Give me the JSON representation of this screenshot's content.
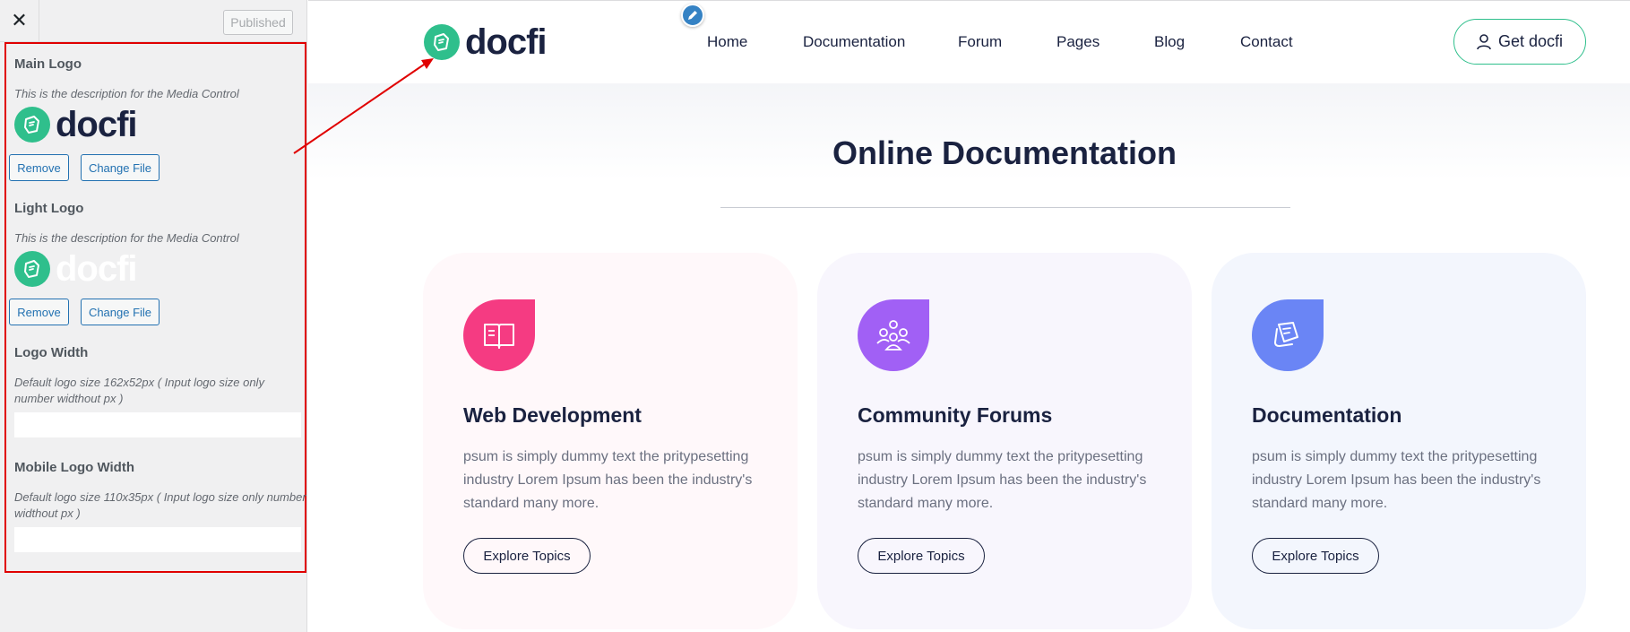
{
  "sidebar": {
    "close_glyph": "✕",
    "published_label": "Published",
    "main_logo": {
      "title": "Main Logo",
      "description": "This is the description for the Media Control",
      "remove_label": "Remove",
      "change_label": "Change File"
    },
    "light_logo": {
      "title": "Light Logo",
      "description": "This is the description for the Media Control",
      "remove_label": "Remove",
      "change_label": "Change File"
    },
    "logo_width": {
      "title": "Logo Width",
      "description": "Default logo size 162x52px ( Input logo size only number widthout px )",
      "value": ""
    },
    "mobile_logo_width": {
      "title": "Mobile Logo Width",
      "description": "Default logo size 110x35px ( Input logo size only number widthout px )",
      "value": ""
    }
  },
  "brand": {
    "name": "docfi",
    "color": "#2fbf8c",
    "dark_text": "#1a2240"
  },
  "header": {
    "nav": [
      "Home",
      "Documentation",
      "Forum",
      "Pages",
      "Blog",
      "Contact"
    ],
    "cta_label": "Get docfi",
    "cta_icon": "user-icon"
  },
  "hero": {
    "title": "Online Documentation"
  },
  "cards": [
    {
      "title": "Web Development",
      "text": "psum is simply dummy text the pritypesetting industry Lorem Ipsum has been the industry's standard many more.",
      "button": "Explore Topics",
      "icon": "book-icon",
      "icon_color": "#f53b82",
      "bg": "#fff8fa"
    },
    {
      "title": "Community Forums",
      "text": "psum is simply dummy text the pritypesetting industry Lorem Ipsum has been the industry's standard many more.",
      "button": "Explore Topics",
      "icon": "community-icon",
      "icon_color": "#a160f5",
      "bg": "#f8f6fd"
    },
    {
      "title": "Documentation",
      "text": "psum is simply dummy text the pritypesetting industry Lorem Ipsum has been the industry's standard many more.",
      "button": "Explore Topics",
      "icon": "documents-icon",
      "icon_color": "#6a85f5",
      "bg": "#f3f6fd"
    }
  ],
  "annotation": {
    "highlight_color": "#e00000"
  }
}
